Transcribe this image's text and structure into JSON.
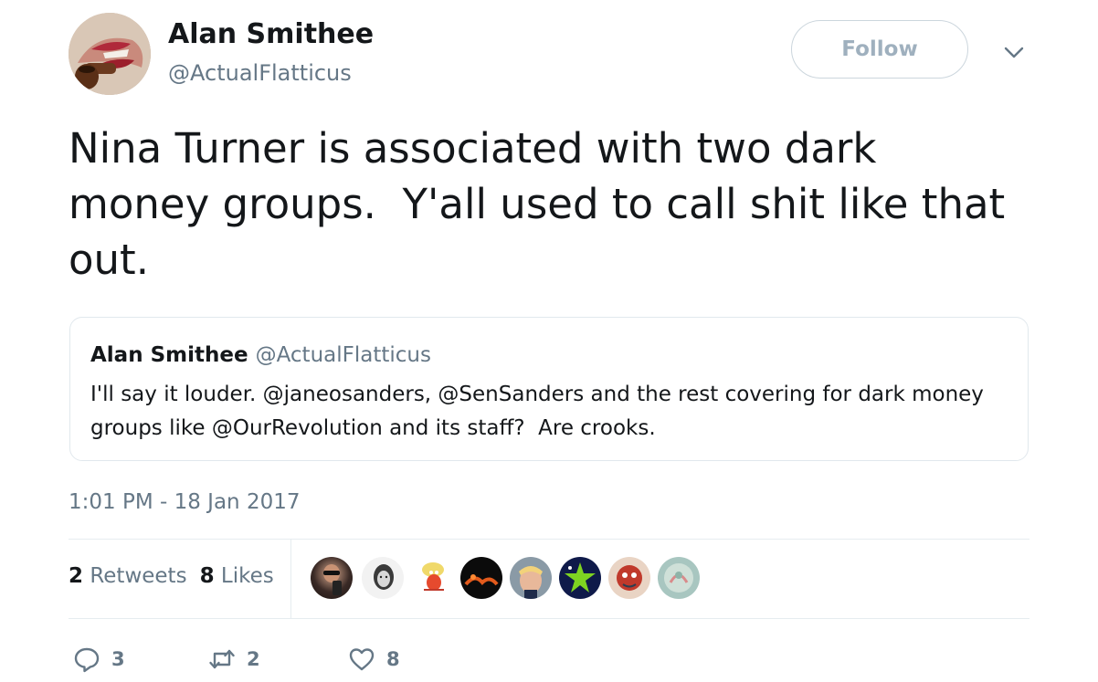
{
  "tweet": {
    "author_name": "Alan Smithee",
    "author_handle": "@ActualFlatticus",
    "follow_label": "Follow",
    "text": "Nina Turner is associated with two dark\nmoney groups.  Y'all used to call shit like that\nout.",
    "quoted": {
      "author_name": "Alan Smithee",
      "author_handle": "@ActualFlatticus",
      "text": "I'll say it louder. @janeosanders, @SenSanders and the rest covering for dark money\ngroups like @OurRevolution and its staff?  Are crooks."
    },
    "timestamp": "1:01 PM - 18 Jan 2017",
    "stats": {
      "retweets_count": "2",
      "retweets_label": "Retweets",
      "likes_count": "8",
      "likes_label": "Likes"
    },
    "actions": {
      "reply_count": "3",
      "retweet_count": "2",
      "like_count": "8"
    }
  },
  "colors": {
    "text_primary": "#14171a",
    "text_secondary": "#657786",
    "border": "#e1e8ed",
    "follow_text": "#9fb0be"
  },
  "icons": {
    "reply": "reply-icon",
    "retweet": "retweet-icon",
    "like": "heart-icon",
    "menu": "chevron-down-icon"
  }
}
